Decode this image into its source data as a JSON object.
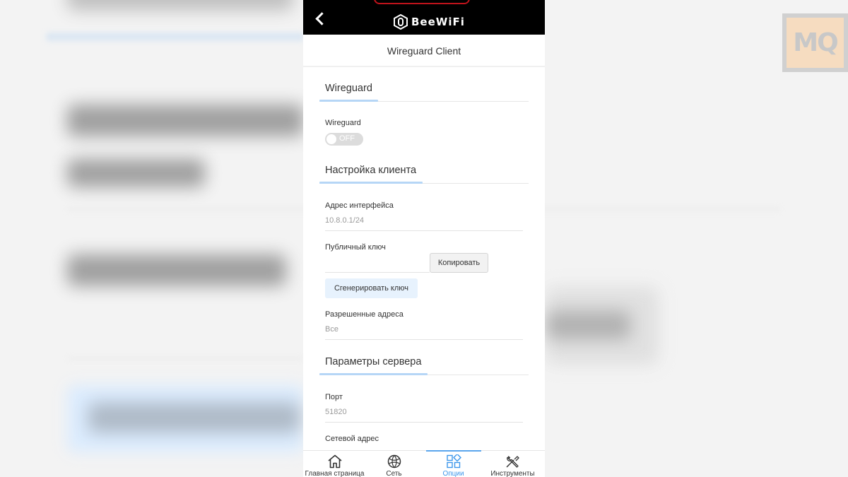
{
  "app": {
    "brand": "BeeWiFi",
    "page_title": "Wireguard Client"
  },
  "watermark": {
    "text": "MQ"
  },
  "sections": {
    "wireguard": {
      "title": "Wireguard"
    },
    "client": {
      "title": "Настройка клиента"
    },
    "server": {
      "title": "Параметры сервера"
    }
  },
  "fields": {
    "wireguard_toggle": {
      "label": "Wireguard",
      "state": "OFF"
    },
    "interface_address": {
      "label": "Адрес интерфейса",
      "value": "10.8.0.1/24"
    },
    "public_key": {
      "label": "Публичный ключ",
      "value": "",
      "copy_label": "Копировать"
    },
    "generate_key": {
      "label": "Сгенерировать ключ"
    },
    "allowed_addresses": {
      "label": "Разрешенные адреса",
      "value": "Все"
    },
    "port": {
      "label": "Порт",
      "value": "51820"
    },
    "network_address": {
      "label": "Сетевой адрес"
    }
  },
  "nav": {
    "items": [
      {
        "label": "Главная страница",
        "icon": "home-icon"
      },
      {
        "label": "Сеть",
        "icon": "globe-icon"
      },
      {
        "label": "Опции",
        "icon": "options-icon",
        "active": true
      },
      {
        "label": "Инструменты",
        "icon": "tools-icon"
      }
    ]
  },
  "colors": {
    "accent": "#3d97eb",
    "section_underline": "#b6d6f6",
    "header_bg": "#000000"
  }
}
